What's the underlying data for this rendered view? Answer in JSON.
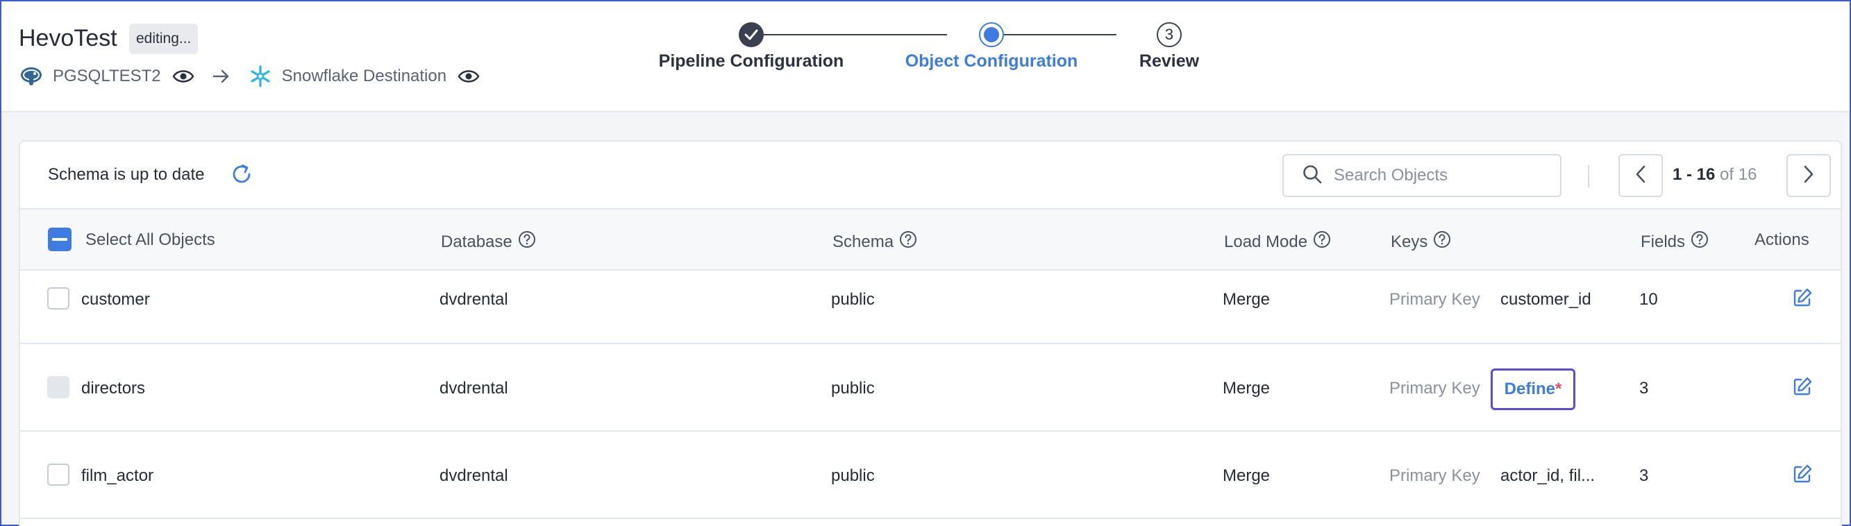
{
  "header": {
    "pipeline_name": "HevoTest",
    "status_badge": "editing...",
    "source_name": "PGSQLTEST2",
    "destination_name": "Snowflake Destination"
  },
  "stepper": {
    "steps": [
      {
        "label": "Pipeline Configuration",
        "state": "done"
      },
      {
        "label": "Object Configuration",
        "state": "active"
      },
      {
        "label": "Review",
        "state": "todo",
        "number": "3"
      }
    ]
  },
  "toolbar": {
    "schema_status": "Schema is up to date",
    "search_placeholder": "Search Objects",
    "pagination": {
      "range": "1 - 16",
      "of_text": "of 16"
    }
  },
  "table": {
    "headers": {
      "select_all": "Select All Objects",
      "database": "Database",
      "schema": "Schema",
      "load_mode": "Load Mode",
      "keys": "Keys",
      "fields": "Fields",
      "actions": "Actions"
    },
    "rows": [
      {
        "object": "customer",
        "database": "dvdrental",
        "schema": "public",
        "load_mode": "Merge",
        "key_type": "Primary Key",
        "key_value": "customer_id",
        "fields": "10"
      },
      {
        "object": "directors",
        "database": "dvdrental",
        "schema": "public",
        "load_mode": "Merge",
        "key_type": "Primary Key",
        "key_action": "Define",
        "key_required_mark": "*",
        "fields": "3"
      },
      {
        "object": "film_actor",
        "database": "dvdrental",
        "schema": "public",
        "load_mode": "Merge",
        "key_type": "Primary Key",
        "key_value": "actor_id, fil...",
        "fields": "3"
      }
    ]
  },
  "colors": {
    "accent": "#3e7ce0",
    "focus_ring": "#5b4bdb",
    "required": "#e84b5f",
    "snowflake": "#29b5e8",
    "postgres": "#336791"
  }
}
